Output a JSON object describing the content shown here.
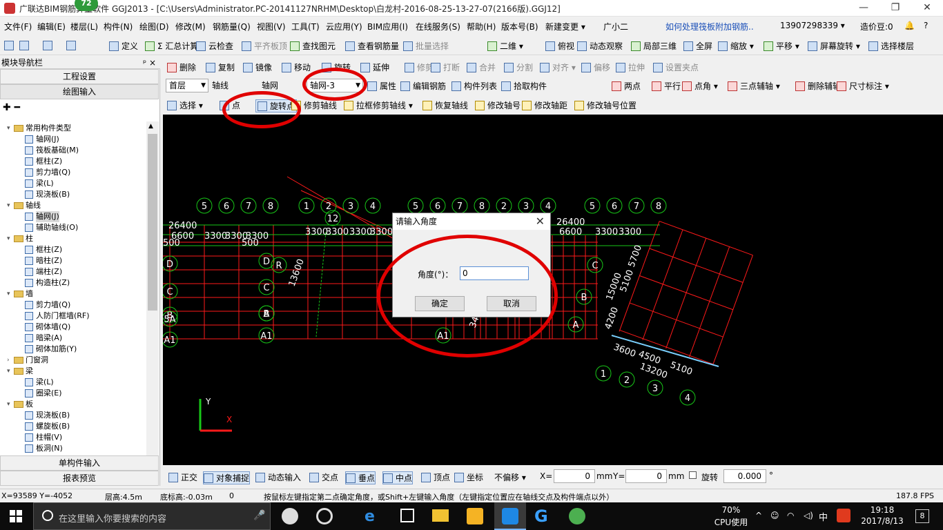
{
  "window": {
    "title": "广联达BIM钢筋算量软件 GGJ2013 - [C:\\Users\\Administrator.PC-20141127NRHM\\Desktop\\白龙村-2016-08-25-13-27-07(2166版).GGJ12]",
    "badge": "72",
    "min": "—",
    "max": "❐",
    "close": "✕"
  },
  "menu": {
    "items": [
      "文件(F)",
      "编辑(E)",
      "楼层(L)",
      "构件(N)",
      "绘图(D)",
      "修改(M)",
      "钢筋量(Q)",
      "视图(V)",
      "工具(T)",
      "云应用(Y)",
      "BIM应用(I)",
      "在线服务(S)",
      "帮助(H)",
      "版本号(B)",
      "新建变更 ▾",
      "广小二",
      "如何处理筏板附加钢筋..",
      "13907298339 ▾",
      "造价豆:0",
      "🔔",
      "?"
    ]
  },
  "toolbar1": {
    "items": [
      "定义",
      "Σ 汇总计算",
      "云检查",
      "平齐板顶",
      "查找图元",
      "查看钢筋量",
      "批量选择",
      "二维 ▾",
      "俯视 ▾",
      "动态观察",
      "局部三维",
      "全屏",
      "缩放 ▾",
      "平移 ▾",
      "屏幕旋转 ▾",
      "选择楼层"
    ]
  },
  "toolbar2": {
    "items": [
      "删除",
      "复制",
      "镜像",
      "移动",
      "旋转",
      "延伸",
      "修剪",
      "打断",
      "合并",
      "分割",
      "对齐 ▾",
      "偏移",
      "拉伸",
      "设置夹点"
    ]
  },
  "toolbar3": {
    "floor": "首层",
    "category": "轴线",
    "type": "轴网",
    "instance": "轴网-3",
    "items": [
      "属性",
      "编辑钢筋",
      "构件列表",
      "拾取构件",
      "两点",
      "平行",
      "点角 ▾",
      "三点辅轴 ▾",
      "删除辅轴",
      "尺寸标注 ▾"
    ]
  },
  "toolbar4": {
    "items": [
      "选择 ▾",
      "点",
      "旋转点",
      "修剪轴线",
      "拉框修剪轴线 ▾",
      "恢复轴线",
      "修改轴号",
      "修改轴距",
      "修改轴号位置"
    ]
  },
  "nav": {
    "header": "模块导航栏",
    "pin": "ᵖ ×",
    "btn_setup": "工程设置",
    "btn_draw": "绘图输入",
    "btn_single": "单构件输入",
    "btn_report": "报表预览",
    "tree": [
      {
        "t": "常用构件类型",
        "lvl": 0,
        "exp": "▾",
        "folder": true
      },
      {
        "t": "轴网(J)",
        "lvl": 1
      },
      {
        "t": "筏板基础(M)",
        "lvl": 1
      },
      {
        "t": "框柱(Z)",
        "lvl": 1
      },
      {
        "t": "剪力墙(Q)",
        "lvl": 1
      },
      {
        "t": "梁(L)",
        "lvl": 1
      },
      {
        "t": "现浇板(B)",
        "lvl": 1
      },
      {
        "t": "轴线",
        "lvl": 0,
        "exp": "▾",
        "folder": true
      },
      {
        "t": "轴网(J)",
        "lvl": 1,
        "sel": true
      },
      {
        "t": "辅助轴线(O)",
        "lvl": 1
      },
      {
        "t": "柱",
        "lvl": 0,
        "exp": "▾",
        "folder": true
      },
      {
        "t": "框柱(Z)",
        "lvl": 1
      },
      {
        "t": "暗柱(Z)",
        "lvl": 1
      },
      {
        "t": "端柱(Z)",
        "lvl": 1
      },
      {
        "t": "构造柱(Z)",
        "lvl": 1
      },
      {
        "t": "墙",
        "lvl": 0,
        "exp": "▾",
        "folder": true
      },
      {
        "t": "剪力墙(Q)",
        "lvl": 1
      },
      {
        "t": "人防门框墙(RF)",
        "lvl": 1
      },
      {
        "t": "砌体墙(Q)",
        "lvl": 1
      },
      {
        "t": "暗梁(A)",
        "lvl": 1
      },
      {
        "t": "砌体加筋(Y)",
        "lvl": 1
      },
      {
        "t": "门窗洞",
        "lvl": 0,
        "exp": "›",
        "folder": true
      },
      {
        "t": "梁",
        "lvl": 0,
        "exp": "▾",
        "folder": true
      },
      {
        "t": "梁(L)",
        "lvl": 1
      },
      {
        "t": "圈梁(E)",
        "lvl": 1
      },
      {
        "t": "板",
        "lvl": 0,
        "exp": "▾",
        "folder": true
      },
      {
        "t": "现浇板(B)",
        "lvl": 1
      },
      {
        "t": "螺旋板(B)",
        "lvl": 1
      },
      {
        "t": "柱帽(V)",
        "lvl": 1
      },
      {
        "t": "板洞(N)",
        "lvl": 1
      }
    ]
  },
  "dialog": {
    "title": "请输入角度",
    "label": "角度(°)：",
    "value": "0",
    "ok": "确定",
    "cancel": "取消"
  },
  "statbar2": {
    "items": [
      "正交",
      "对象捕捉",
      "动态输入",
      "交点",
      "垂点",
      "中点",
      "顶点",
      "坐标",
      "不偏移 ▾"
    ],
    "x_label": "X=",
    "x_val": "0",
    "mm1": "mm",
    "y_label": "Y=",
    "y_val": "0",
    "mm2": "mm",
    "rot_label": "旋转",
    "rot_val": "0.000",
    "deg": "°"
  },
  "status": {
    "coords": "X=93589 Y=-4052",
    "floor_h": "层高:4.5m",
    "base_h": "底标高:-0.03m",
    "zero": "0",
    "hint": "按鼠标左键指定第二点确定角度，或Shift+左键输入角度（左键指定位置应在轴线交点及构件端点以外）",
    "fps": "187.8 FPS"
  },
  "taskbar": {
    "search": "在这里输入你要搜索的内容",
    "cpu_pct": "70%",
    "cpu_label": "CPU使用",
    "ime": "中",
    "time": "19:18",
    "date": "2017/8/13",
    "notif": "8"
  },
  "drawing": {
    "top_labels": [
      "5",
      "6",
      "7",
      "8",
      "1",
      "2",
      "3",
      "4",
      "5",
      "6",
      "7",
      "8",
      "2",
      "3",
      "4",
      "5",
      "6",
      "7",
      "8"
    ],
    "dims": [
      "26400",
      "6600",
      "3300",
      "3300",
      "3300",
      "3300",
      "3300",
      "3300",
      "3300",
      "26400",
      "6600",
      "3300",
      "3300",
      "500",
      "500",
      "13600",
      "3400",
      "5700",
      "15000",
      "5100",
      "4200",
      "3600",
      "4500",
      "5100",
      "13200"
    ],
    "left_rows": [
      "D",
      "C",
      "B",
      "5A",
      "A1",
      "D",
      "C",
      "B",
      "A",
      "A1",
      "R",
      "C",
      "B",
      "A",
      "A1",
      "12"
    ],
    "rot_bottom": [
      "1",
      "2",
      "3",
      "4"
    ],
    "axis_y": "Y",
    "axis_x": "X"
  },
  "colors": {
    "canvas": "#000000",
    "grid": "#ff0000",
    "axis": "#00c000",
    "bubble": "#00cc00",
    "highlight": "#e00000"
  }
}
